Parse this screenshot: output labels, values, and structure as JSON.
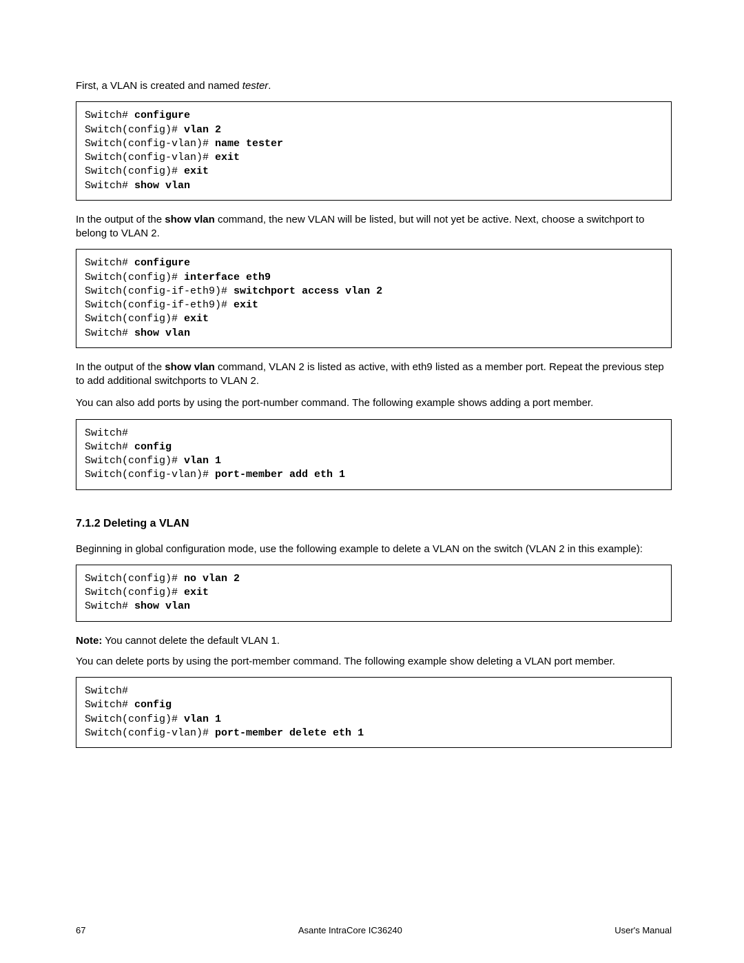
{
  "para1_pre": "First, a VLAN is created and named ",
  "para1_em": "tester",
  "para1_post": ".",
  "cb1": {
    "l1p": "Switch# ",
    "l1c": "configure",
    "l2p": "Switch(config)# ",
    "l2c": "vlan 2",
    "l3p": "Switch(config-vlan)# ",
    "l3c": "name tester",
    "l4p": "Switch(config-vlan)# ",
    "l4c": "exit",
    "l5p": "Switch(config)# ",
    "l5c": "exit",
    "l6p": "Switch# ",
    "l6c": "show vlan"
  },
  "para2_a": "In the output of the ",
  "para2_b": "show vlan",
  "para2_c": " command, the new VLAN will be listed, but will not yet be active. Next, choose a switchport to belong to VLAN 2.",
  "cb2": {
    "l1p": "Switch# ",
    "l1c": "configure",
    "l2p": "Switch(config)# ",
    "l2c": "interface eth9",
    "l3p": "Switch(config-if-eth9)# ",
    "l3c": "switchport access vlan 2",
    "l4p": "Switch(config-if-eth9)# ",
    "l4c": "exit",
    "l5p": "Switch(config)# ",
    "l5c": "exit",
    "l6p": "Switch# ",
    "l6c": "show vlan"
  },
  "para3_a": "In the output of the ",
  "para3_b": "show vlan",
  "para3_c": " command, VLAN 2 is listed as active, with eth9 listed as a member port. Repeat the previous step to add additional switchports to VLAN 2.",
  "para4": "You can also add ports by using the port-number command. The following example shows adding a port member.",
  "cb3": {
    "l1": "Switch#",
    "l2p": "Switch# ",
    "l2c": "config",
    "l3p": "Switch(config)# ",
    "l3c": "vlan 1",
    "l4p": "Switch(config-vlan)# ",
    "l4c": "port-member add eth 1"
  },
  "heading": "7.1.2 Deleting a VLAN",
  "para5": "Beginning in global configuration mode, use the following example to delete a VLAN on the switch (VLAN 2 in this example):",
  "cb4": {
    "l1p": "Switch(config)# ",
    "l1c": "no vlan 2",
    "l2p": "Switch(config)# ",
    "l2c": "exit",
    "l3p": "Switch# ",
    "l3c": "show vlan"
  },
  "para6_a": "Note:",
  "para6_b": " You cannot delete the default VLAN 1.",
  "para7": "You can delete ports by using the port-member command. The following example show deleting a VLAN port member.",
  "cb5": {
    "l1": "Switch#",
    "l2p": "Switch# ",
    "l2c": "config",
    "l3p": "Switch(config)# ",
    "l3c": "vlan 1",
    "l4p": "Switch(config-vlan)# ",
    "l4c": "port-member delete eth 1"
  },
  "footer": {
    "page": "67",
    "center": "Asante IntraCore IC36240",
    "right": "User's Manual"
  }
}
